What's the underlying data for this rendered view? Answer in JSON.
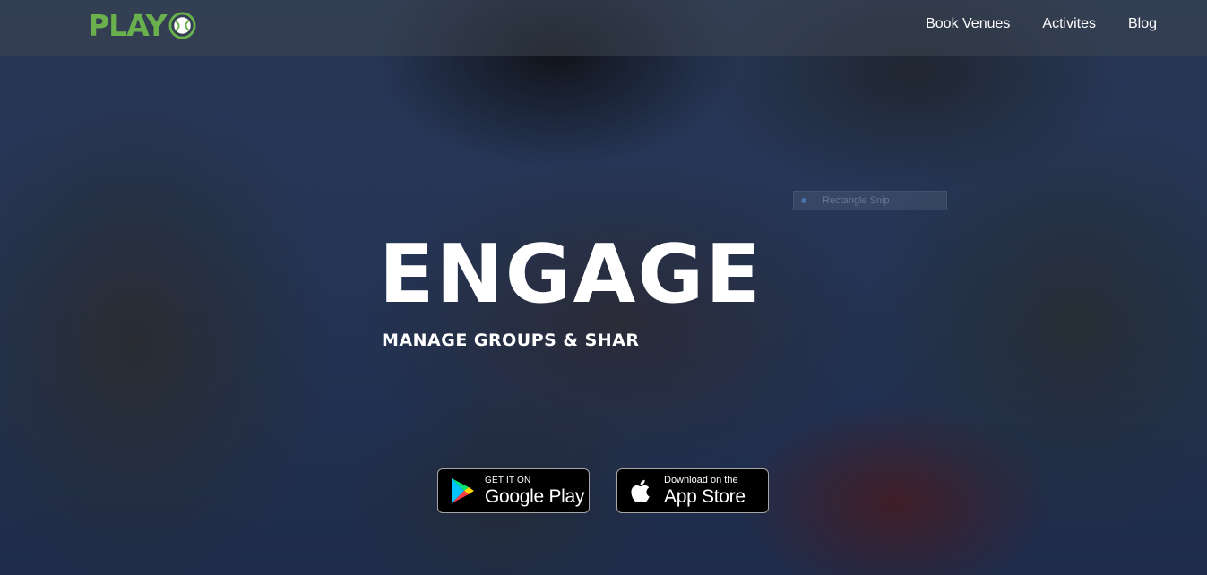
{
  "brand": {
    "logo_text": "PLAY",
    "logo_color": "#6ab04c"
  },
  "nav": {
    "items": [
      {
        "label": "Book Venues"
      },
      {
        "label": "Activites"
      },
      {
        "label": "Blog"
      }
    ]
  },
  "overlay": {
    "ghost_label": "Rectangle Snip"
  },
  "hero": {
    "headline": "ENGAGE",
    "subheadline": "MANAGE GROUPS & SHAR"
  },
  "stores": {
    "google_play": {
      "small": "GET IT ON",
      "big": "Google Play"
    },
    "app_store": {
      "small": "Download on the",
      "big": "App Store"
    }
  }
}
